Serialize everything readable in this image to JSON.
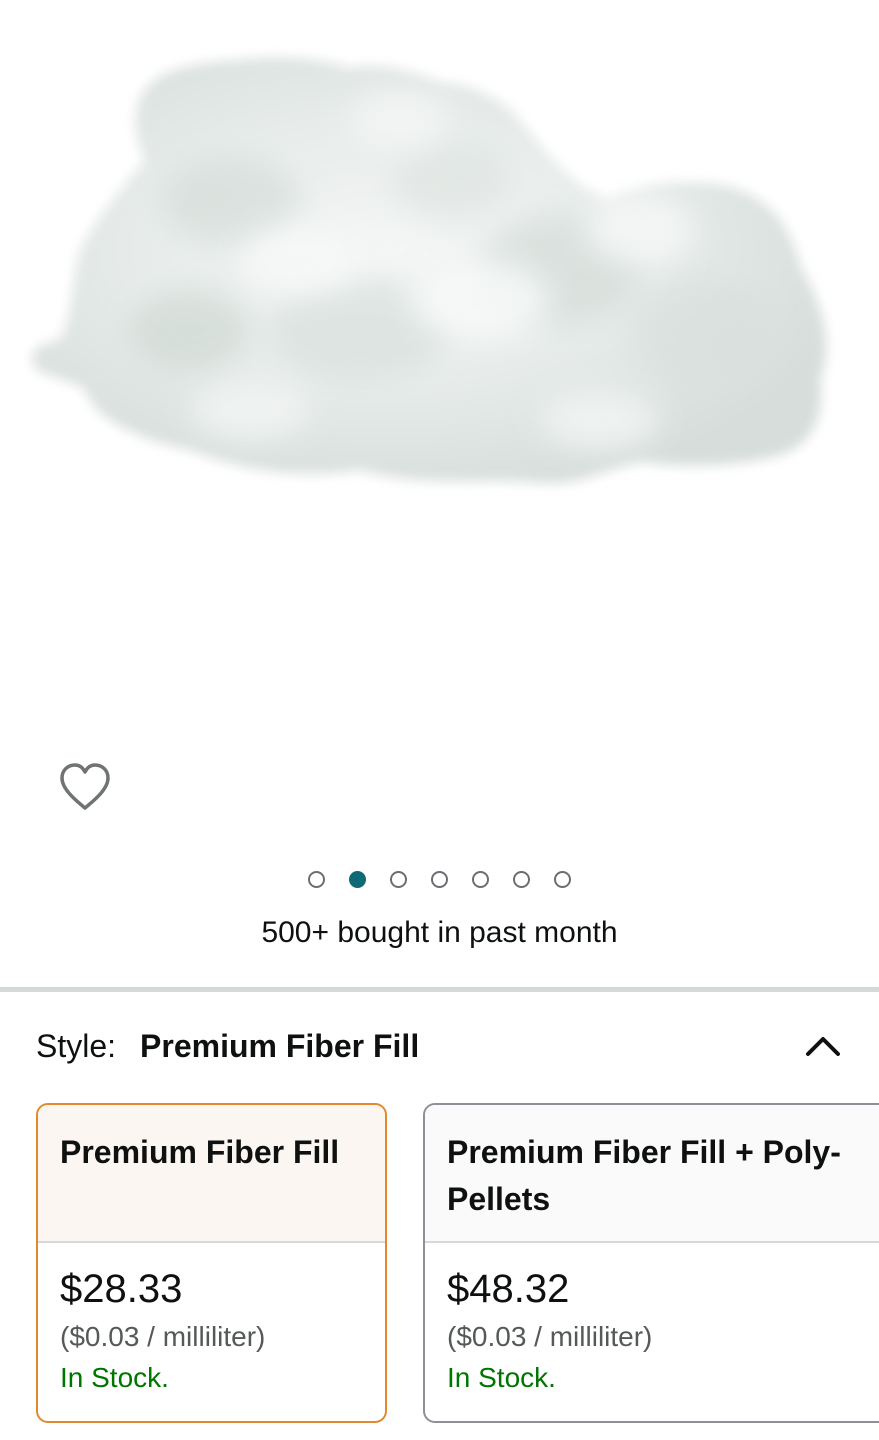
{
  "gallery": {
    "image_alt": "white polyester fiber fill stuffing",
    "dot_count": 7,
    "active_index": 1,
    "bought_text": "500+ bought in past month"
  },
  "style_selector": {
    "label": "Style:",
    "selected_value": "Premium Fiber Fill"
  },
  "options": [
    {
      "title": "Premium Fiber Fill",
      "price": "$28.33",
      "unit_price": "($0.03 / milliliter)",
      "stock": "In Stock.",
      "selected": true
    },
    {
      "title": "Premium Fiber Fill + Poly-Pellets",
      "price": "$48.32",
      "unit_price": "($0.03 / milliliter)",
      "stock": "In Stock.",
      "selected": false
    }
  ],
  "colors": {
    "accent_selected": "#e3892d",
    "dot_active": "#0e6a77",
    "stock_green": "#007600"
  },
  "icons": [
    "heart-outline-icon",
    "chevron-up-icon"
  ]
}
